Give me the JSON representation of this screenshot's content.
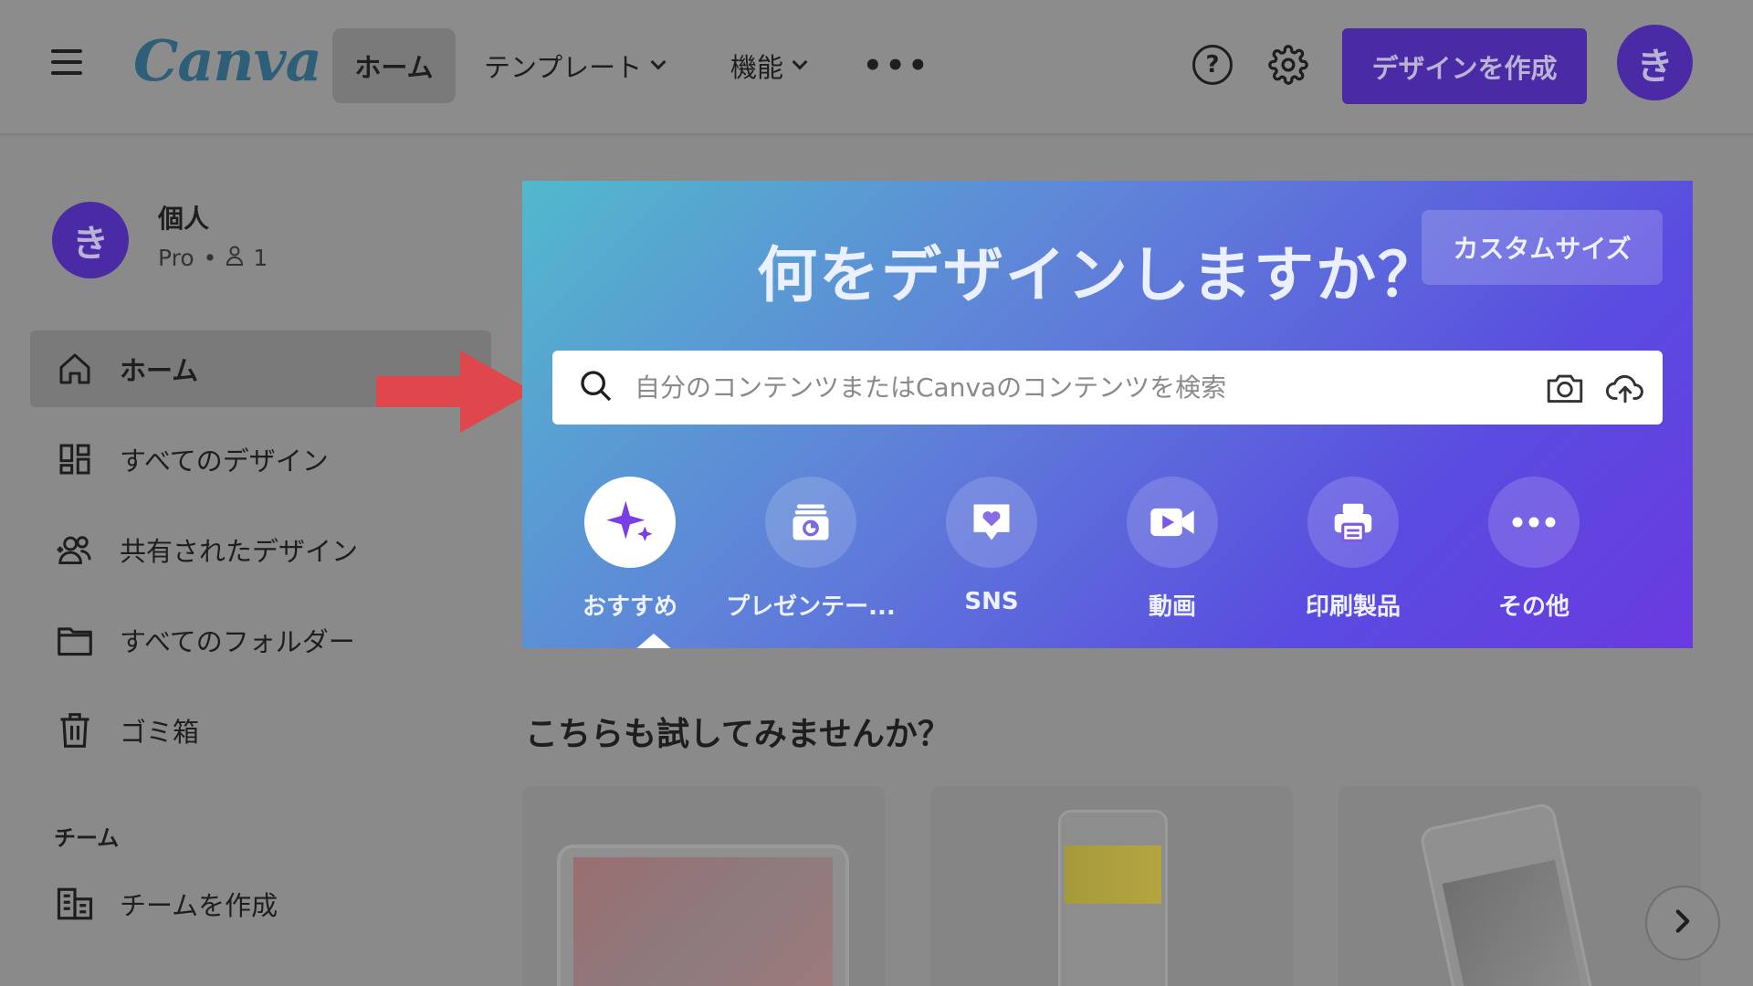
{
  "header": {
    "logo": "Canva",
    "nav": {
      "home": "ホーム",
      "templates": "テンプレート",
      "features": "機能",
      "more": "•••"
    },
    "help": "?",
    "create_label": "デザインを作成",
    "avatar_initial": "き"
  },
  "profile": {
    "initial": "き",
    "name": "個人",
    "plan": "Pro",
    "separator": "•",
    "member_count": "1"
  },
  "sidebar": {
    "items": [
      {
        "label": "ホーム",
        "icon": "home-icon"
      },
      {
        "label": "すべてのデザイン",
        "icon": "grid-icon"
      },
      {
        "label": "共有されたデザイン",
        "icon": "people-icon"
      },
      {
        "label": "すべてのフォルダー",
        "icon": "folder-icon"
      },
      {
        "label": "ゴミ箱",
        "icon": "trash-icon"
      }
    ],
    "team_section": "チーム",
    "team_create": "チームを作成"
  },
  "hero": {
    "title": "何をデザインしますか？",
    "custom_size": "カスタムサイズ",
    "search_placeholder": "自分のコンテンツまたはCanvaのコンテンツを検索",
    "categories": [
      {
        "label": "おすすめ",
        "icon": "sparkle-icon",
        "selected": true
      },
      {
        "label": "プレゼンテー...",
        "icon": "presentation-icon"
      },
      {
        "label": "SNS",
        "icon": "heart-chat-icon"
      },
      {
        "label": "動画",
        "icon": "video-icon"
      },
      {
        "label": "印刷製品",
        "icon": "printer-icon"
      },
      {
        "label": "その他",
        "icon": "more-icon"
      }
    ]
  },
  "suggestions": {
    "title": "こちらも試してみませんか？"
  },
  "colors": {
    "brand_purple": "#4a2aa5",
    "annotation_arrow": "#e0474c"
  }
}
